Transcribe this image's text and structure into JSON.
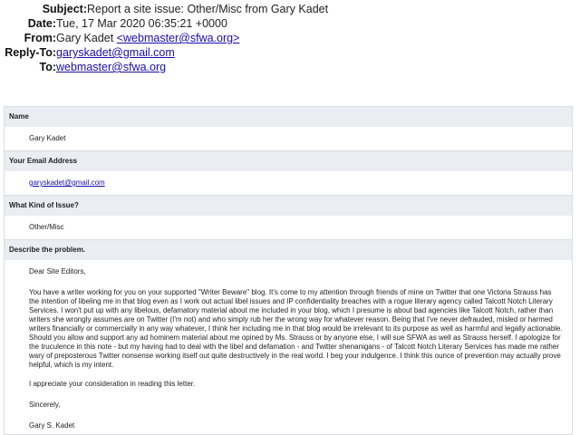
{
  "headers": {
    "subject_label": "Subject:",
    "subject_value": "Report a site issue: Other/Misc from Gary Kadet",
    "date_label": "Date:",
    "date_value": "Tue, 17 Mar 2020 06:35:21 +0000",
    "from_label": "From:",
    "from_name": "Gary Kadet",
    "from_email": "<webmaster@sfwa.org>",
    "replyto_label": "Reply-To:",
    "replyto_email": "garyskadet@gmail.com",
    "to_label": "To:",
    "to_email": "webmaster@sfwa.org"
  },
  "form": {
    "name_label": "Name",
    "name_value": "Gary Kadet",
    "email_label": "Your Email Address",
    "email_value": "garyskadet@gmail.com",
    "issue_label": "What Kind of Issue?",
    "issue_value": "Other/Misc",
    "problem_label": "Describe the problem.",
    "greeting": "Dear Site Editors,",
    "body": "You have a writer working for you on your supported \"Writer Beware\" blog. It's come to my attention through friends of mine on Twitter that one Victoria Strauss has the intention of libeling me in that blog even as I work out actual libel issues and IP confidentiality breaches with a rogue literary agency called Talcott Notch Literary Services. I won't put up with any libelous, defamatory material about me included in your blog, which I presume is about bad agencies like Talcott Notch, rather than writers she wrongly assumes are on Twitter (I'm not) and who simply rub her the wrong way for whatever reason. Being that I've never defrauded, misled or harmed writers financially or commercially in any way whatever, I think her including me in that blog would be irrelevant to its purpose as well as harmful and legally actionable. Should you allow and support any ad hominem material about me opined by Ms. Strauss or by anyone else, I will sue SFWA as well as Strauss herself. I apologize for the truculence in this note - but my having had to deal with the libel and defamation - and Twitter shenanigans - of Talcott Notch Literary Services has made me rather wary of preposterous Twitter nonsense working itself out quite destructively in the real world. I beg your indulgence. I think this ounce of prevention may actually prove helpful, which is my intent.",
    "appreciation": "I appreciate your consideration in reading this letter.",
    "closing": "Sincerely,",
    "signature": "Gary S. Kadet"
  }
}
